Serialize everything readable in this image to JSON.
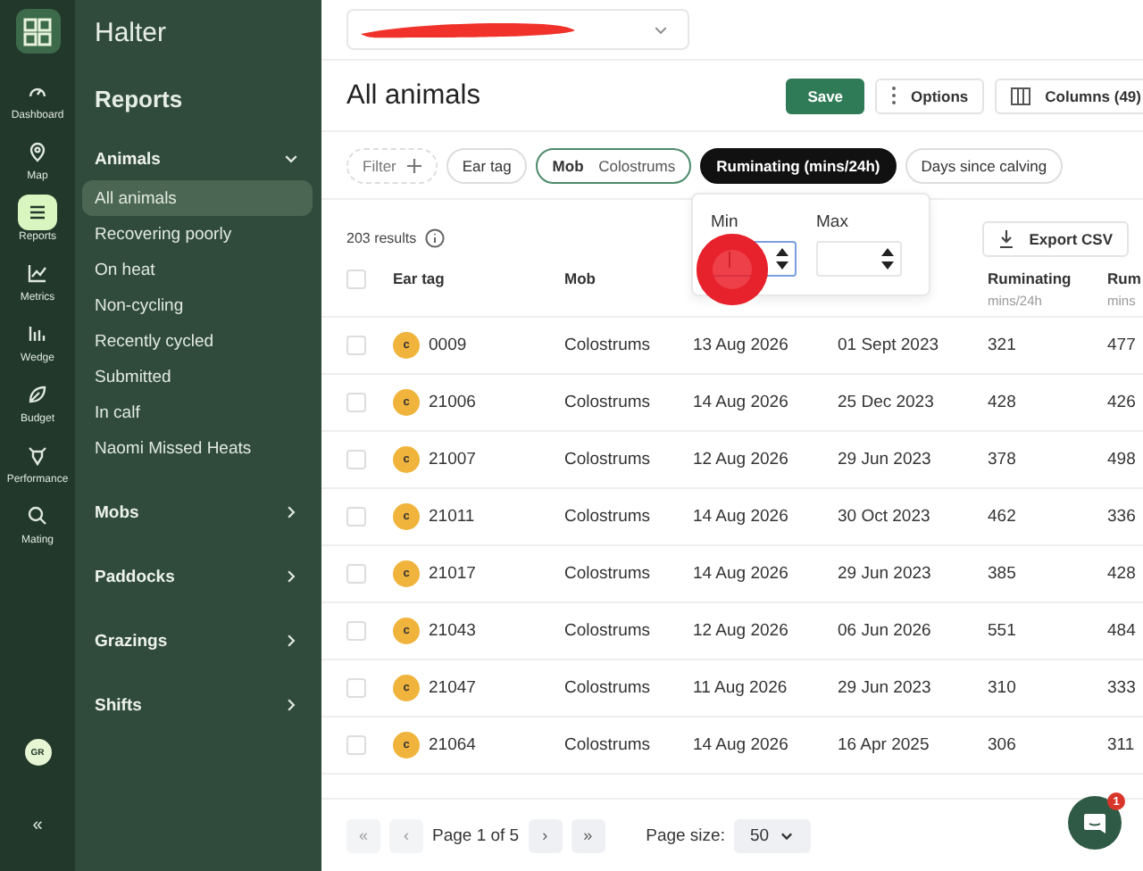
{
  "nav_rail": {
    "items": [
      {
        "label": "Dashboard",
        "selected": false
      },
      {
        "label": "Map",
        "selected": false
      },
      {
        "label": "Reports",
        "selected": true
      },
      {
        "label": "Metrics",
        "selected": false
      },
      {
        "label": "Wedge",
        "selected": false
      },
      {
        "label": "Budget",
        "selected": false
      },
      {
        "label": "Performance",
        "selected": false
      },
      {
        "label": "Mating",
        "selected": false
      }
    ],
    "avatar": "GR",
    "collapse": "«"
  },
  "sidebar": {
    "brand": "Halter",
    "title": "Reports",
    "sections": [
      {
        "label": "Animals",
        "expanded": true,
        "items": [
          {
            "label": "All animals",
            "selected": true
          },
          {
            "label": "Recovering poorly",
            "selected": false
          },
          {
            "label": "On heat",
            "selected": false
          },
          {
            "label": "Non-cycling",
            "selected": false
          },
          {
            "label": "Recently cycled",
            "selected": false
          },
          {
            "label": "Submitted",
            "selected": false
          },
          {
            "label": "In calf",
            "selected": false
          },
          {
            "label": "Naomi Missed Heats",
            "selected": false
          }
        ]
      },
      {
        "label": "Mobs",
        "expanded": false
      },
      {
        "label": "Paddocks",
        "expanded": false
      },
      {
        "label": "Grazings",
        "expanded": false
      },
      {
        "label": "Shifts",
        "expanded": false
      }
    ]
  },
  "page": {
    "title": "All animals",
    "buttons": [
      {
        "label": "Save",
        "kind": "primary"
      },
      {
        "label": "Options",
        "kind": "options"
      },
      {
        "label": "Columns (49)",
        "kind": "columns"
      }
    ]
  },
  "filters": [
    {
      "label": "Filter",
      "kind": "add"
    },
    {
      "label": "Ear tag",
      "kind": "plain"
    },
    {
      "label": "Mob",
      "value": "Colostrums",
      "kind": "value"
    },
    {
      "label": "Ruminating (mins/24h)",
      "kind": "active"
    },
    {
      "label": "Days since calving",
      "kind": "plain"
    }
  ],
  "range_popover": {
    "min_label": "Min",
    "max_label": "Max",
    "min_focused": true
  },
  "results": "203 results",
  "export": "Export CSV",
  "table": {
    "select_all": {
      "checked": false
    },
    "columns": [
      {
        "label": "Ear tag"
      },
      {
        "label": "Mob"
      },
      {},
      {},
      {
        "label": "Ruminating",
        "sub": "mins/24h"
      },
      {
        "label": "Rum",
        "sub": "mins"
      }
    ],
    "rows": [
      {
        "checked": false,
        "badge": "c",
        "cells": [
          "0009",
          "Colostrums",
          "13 Aug 2026",
          "01 Sept 2023",
          "321",
          "477"
        ]
      },
      {
        "checked": false,
        "badge": "c",
        "cells": [
          "21006",
          "Colostrums",
          "14 Aug 2026",
          "25 Dec 2023",
          "428",
          "426"
        ]
      },
      {
        "checked": false,
        "badge": "c",
        "cells": [
          "21007",
          "Colostrums",
          "12 Aug 2026",
          "29 Jun 2023",
          "378",
          "498"
        ]
      },
      {
        "checked": false,
        "badge": "c",
        "cells": [
          "21011",
          "Colostrums",
          "14 Aug 2026",
          "30 Oct 2023",
          "462",
          "336"
        ]
      },
      {
        "checked": false,
        "badge": "c",
        "cells": [
          "21017",
          "Colostrums",
          "14 Aug 2026",
          "29 Jun 2023",
          "385",
          "428"
        ]
      },
      {
        "checked": false,
        "badge": "c",
        "cells": [
          "21043",
          "Colostrums",
          "12 Aug 2026",
          "06 Jun 2026",
          "551",
          "484"
        ]
      },
      {
        "checked": false,
        "badge": "c",
        "cells": [
          "21047",
          "Colostrums",
          "11 Aug 2026",
          "29 Jun 2023",
          "310",
          "333"
        ]
      },
      {
        "checked": false,
        "badge": "c",
        "cells": [
          "21064",
          "Colostrums",
          "14 Aug 2026",
          "16 Apr 2025",
          "306",
          "311"
        ]
      }
    ]
  },
  "pagination": {
    "first": {
      "label": "«",
      "disabled": true
    },
    "prev": {
      "label": "‹",
      "disabled": true
    },
    "page": "Page 1 of 5",
    "next": {
      "label": "›",
      "disabled": false
    },
    "last": {
      "label": "»",
      "disabled": false
    },
    "size_label": "Page size:",
    "size": "50"
  },
  "chat": {
    "badge": "1"
  }
}
